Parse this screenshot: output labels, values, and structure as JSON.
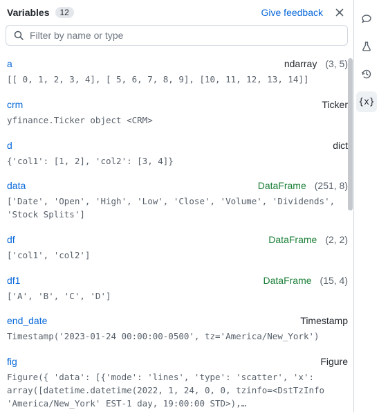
{
  "header": {
    "title": "Variables",
    "count": "12",
    "feedback": "Give feedback"
  },
  "filter": {
    "placeholder": "Filter by name or type"
  },
  "rail": {
    "variables_glyph": "{x}"
  },
  "variables": [
    {
      "name": "a",
      "type": "ndarray",
      "type_class": "type-default",
      "shape": "(3, 5)",
      "value": "[[ 0,  1,  2,  3,  4], [ 5,  6,  7,  8,  9], [10, 11, 12, 13, 14]]"
    },
    {
      "name": "crm",
      "type": "Ticker",
      "type_class": "type-default",
      "shape": "",
      "value": "yfinance.Ticker object <CRM>"
    },
    {
      "name": "d",
      "type": "dict",
      "type_class": "type-default",
      "shape": "",
      "value": "{'col1': [1, 2], 'col2': [3, 4]}"
    },
    {
      "name": "data",
      "type": "DataFrame",
      "type_class": "type-green",
      "shape": "(251, 8)",
      "value": "['Date', 'Open', 'High', 'Low', 'Close', 'Volume', 'Dividends', 'Stock Splits']"
    },
    {
      "name": "df",
      "type": "DataFrame",
      "type_class": "type-green",
      "shape": "(2, 2)",
      "value": "['col1', 'col2']"
    },
    {
      "name": "df1",
      "type": "DataFrame",
      "type_class": "type-green",
      "shape": "(15, 4)",
      "value": "['A', 'B', 'C', 'D']"
    },
    {
      "name": "end_date",
      "type": "Timestamp",
      "type_class": "type-default",
      "shape": "",
      "value": "Timestamp('2023-01-24 00:00:00-0500', tz='America/New_York')"
    },
    {
      "name": "fig",
      "type": "Figure",
      "type_class": "type-default",
      "shape": "",
      "value": "Figure({ 'data': [{'mode': 'lines', 'type': 'scatter', 'x': array([datetime.datetime(2022, 1, 24, 0, 0, tzinfo=<DstTzInfo 'America/New_York' EST-1 day, 19:00:00 STD>),…"
    }
  ]
}
